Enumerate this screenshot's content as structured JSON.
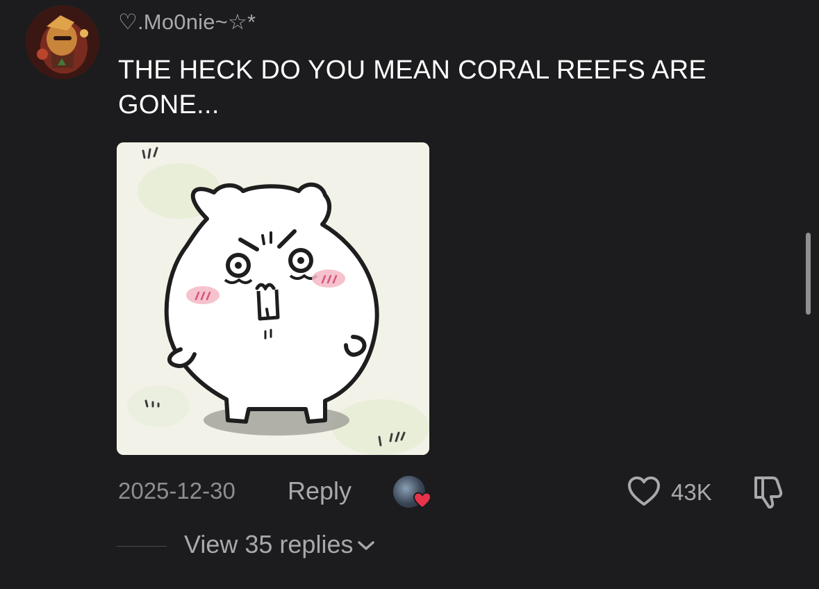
{
  "comment": {
    "username": "♡.Mo0nie~☆*",
    "text": "THE HECK DO YOU MEAN CORAL REEFS ARE GONE...",
    "date": "2025-12-30",
    "reply_label": "Reply",
    "like_count": "43K",
    "view_replies_label": "View 35 replies"
  },
  "icons": {
    "like": "heart-outline-icon",
    "dislike": "thumbs-down-icon",
    "expand": "chevron-down-icon",
    "liked_by_heart": "heart-filled-icon"
  },
  "colors": {
    "background": "#1c1c1e",
    "primary_text": "#ffffff",
    "secondary_text": "#a9a9ad",
    "heart_badge": "#e8334a"
  }
}
